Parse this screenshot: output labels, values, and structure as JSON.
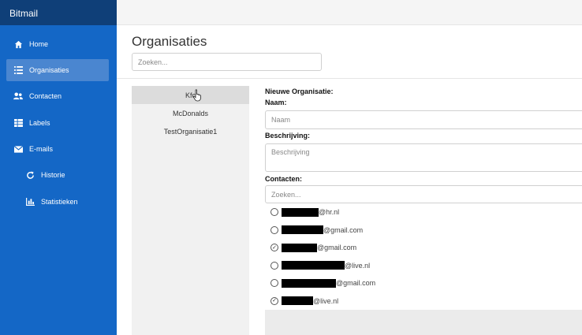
{
  "app": {
    "brand": "Bitmail"
  },
  "sidebar": {
    "items": [
      {
        "label": "Home",
        "icon": "home-icon",
        "active": false
      },
      {
        "label": "Organisaties",
        "icon": "list-icon",
        "active": true
      },
      {
        "label": "Contacten",
        "icon": "users-icon",
        "active": false
      },
      {
        "label": "Labels",
        "icon": "labels-icon",
        "active": false
      },
      {
        "label": "E-mails",
        "icon": "envelope-icon",
        "active": false
      },
      {
        "label": "Historie",
        "icon": "refresh-icon",
        "active": false
      },
      {
        "label": "Statistieken",
        "icon": "bar-chart-icon",
        "active": false
      }
    ]
  },
  "page": {
    "title": "Organisaties",
    "search_placeholder": "Zoeken..."
  },
  "organisations": [
    "Kfc",
    "McDonalds",
    "TestOrganisatie1"
  ],
  "form": {
    "heading": "Nieuwe Organisatie:",
    "name_label": "Naam:",
    "name_placeholder": "Naam",
    "description_label": "Beschrijving:",
    "description_placeholder": "Beschrijving",
    "contacts_label": "Contacten:",
    "contacts_search_placeholder": "Zoeken...",
    "contacts": [
      {
        "domain": "@hr.nl",
        "checked": false
      },
      {
        "domain": "@gmail.com",
        "checked": false
      },
      {
        "domain": "@gmail.com",
        "checked": true
      },
      {
        "domain": "@live.nl",
        "checked": false
      },
      {
        "domain": "@gmail.com",
        "checked": false
      },
      {
        "domain": "@live.nl",
        "checked": true
      }
    ]
  },
  "colors": {
    "sidebar": "#1467c6",
    "brand_bar": "#0f3f78",
    "active_item": "#4a86d0"
  }
}
